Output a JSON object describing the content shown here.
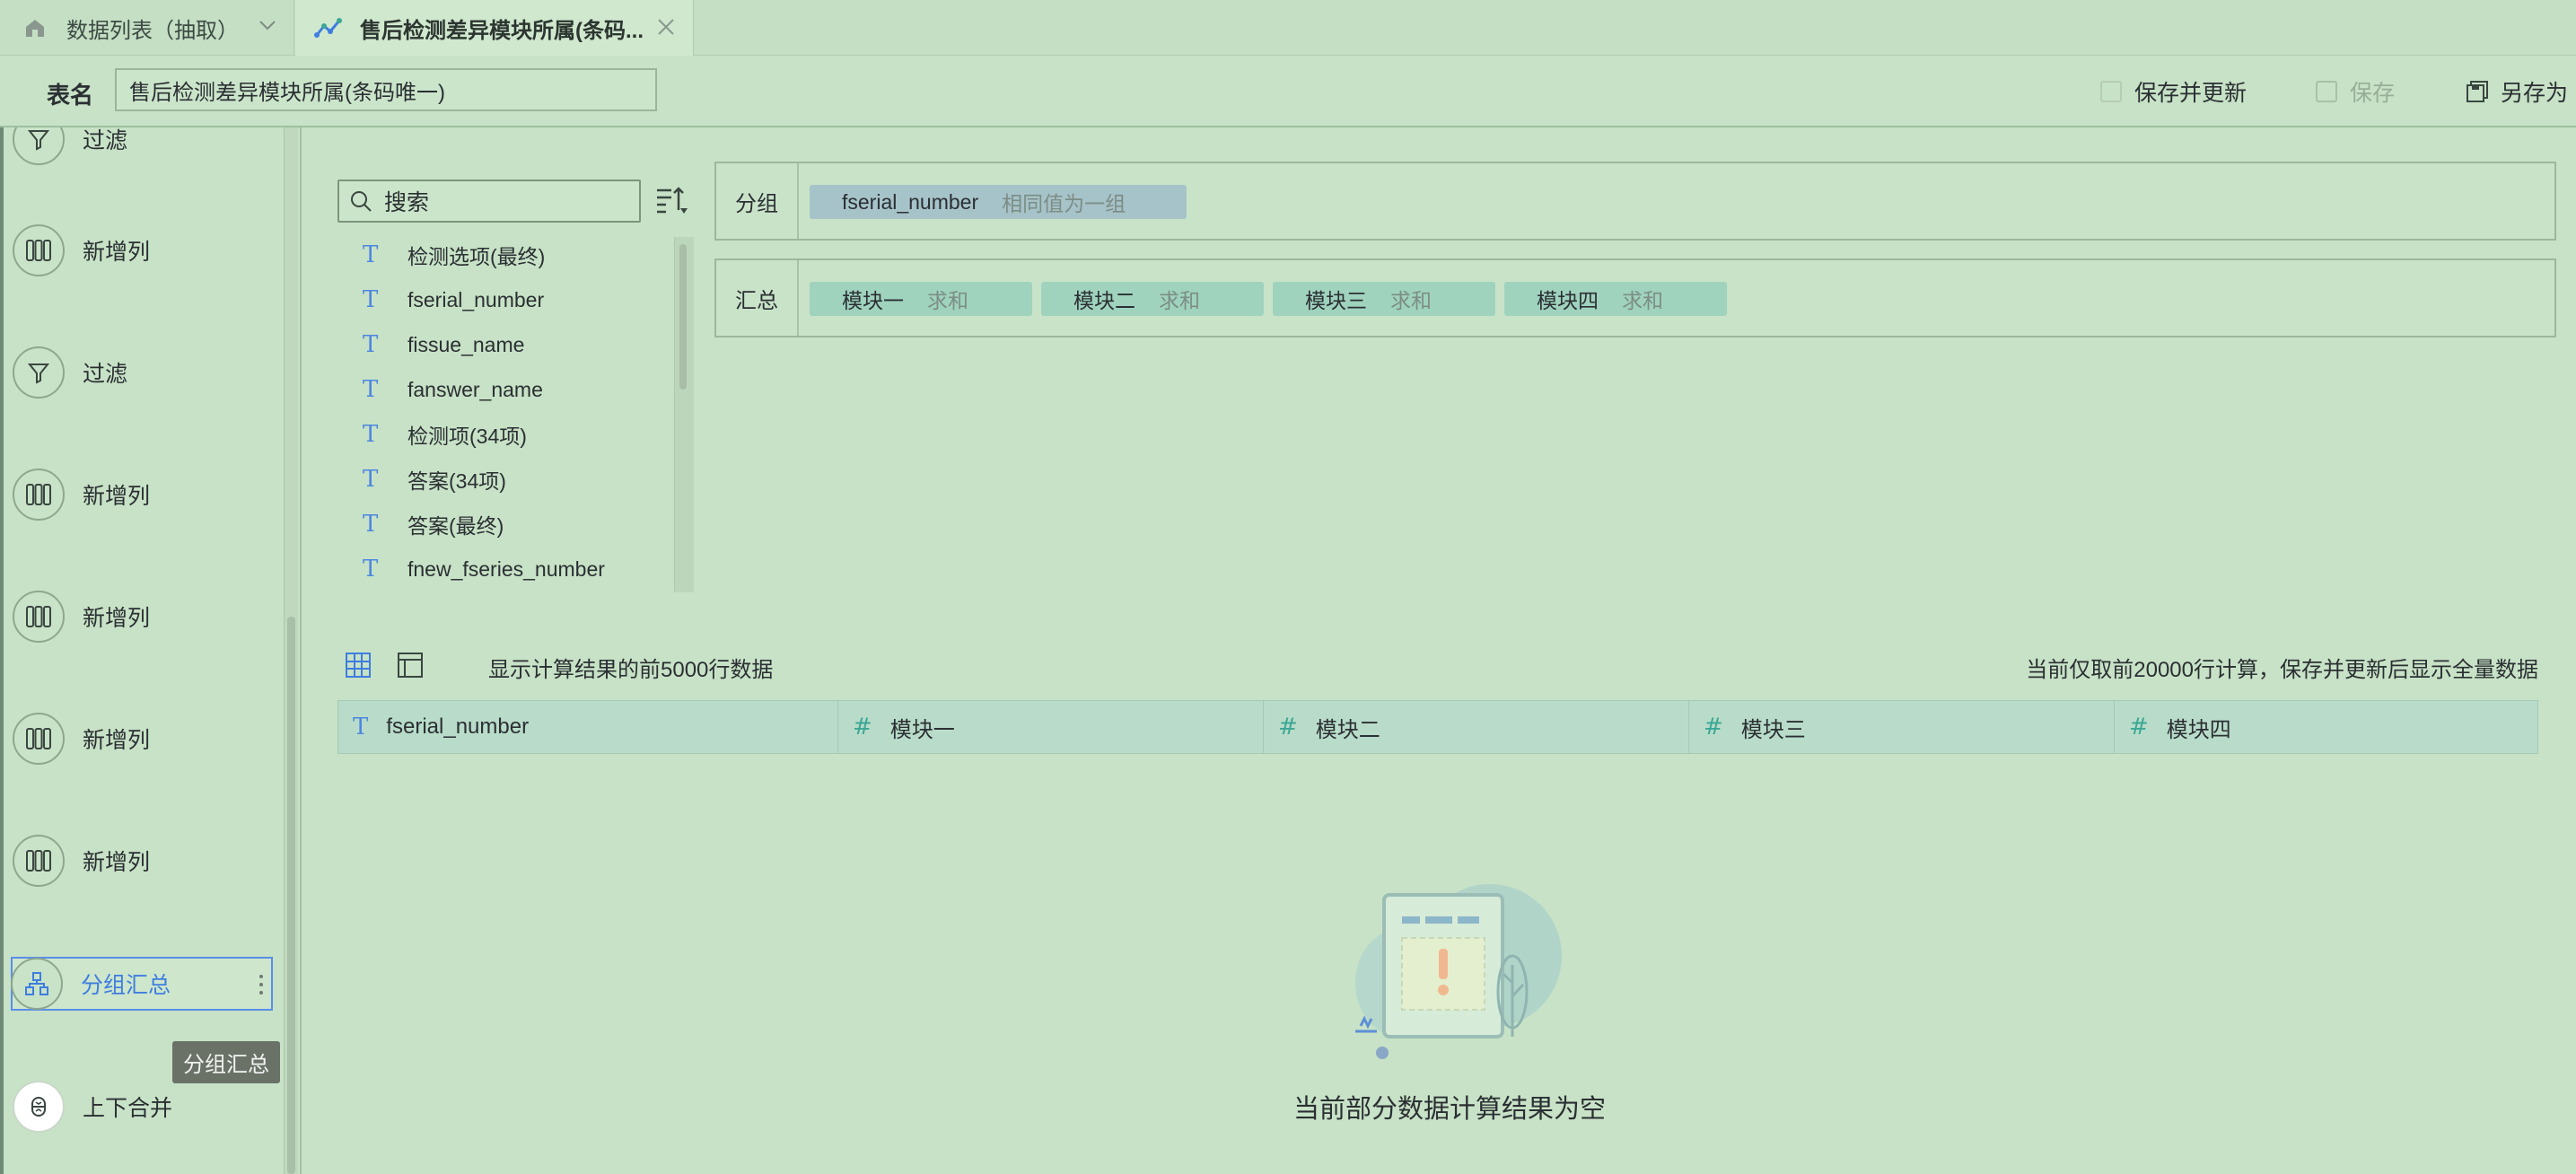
{
  "tabs": [
    {
      "label": "数据列表（抽取）"
    },
    {
      "label": "售后检测差异模块所属(条码..."
    }
  ],
  "header": {
    "table_name_label": "表名",
    "table_name_value": "售后检测差异模块所属(条码唯一)",
    "save_update_label": "保存并更新",
    "save_label": "保存",
    "save_as_label": "另存为"
  },
  "sidebar": {
    "steps": [
      {
        "label": "过滤",
        "icon": "filter-icon"
      },
      {
        "label": "新增列",
        "icon": "add-column-icon"
      },
      {
        "label": "过滤",
        "icon": "filter-icon"
      },
      {
        "label": "新增列",
        "icon": "add-column-icon"
      },
      {
        "label": "新增列",
        "icon": "add-column-icon"
      },
      {
        "label": "新增列",
        "icon": "add-column-icon"
      },
      {
        "label": "新增列",
        "icon": "add-column-icon"
      },
      {
        "label": "分组汇总",
        "icon": "group-summary-icon",
        "active": true
      },
      {
        "label": "上下合并",
        "icon": "merge-icon"
      }
    ],
    "tooltip": "分组汇总"
  },
  "fields": {
    "search_placeholder": "搜索",
    "items": [
      {
        "type": "T",
        "name": "检测选项(最终)"
      },
      {
        "type": "T",
        "name": "fserial_number"
      },
      {
        "type": "T",
        "name": "fissue_name"
      },
      {
        "type": "T",
        "name": "fanswer_name"
      },
      {
        "type": "T",
        "name": "检测项(34项)"
      },
      {
        "type": "T",
        "name": "答案(34项)"
      },
      {
        "type": "T",
        "name": "答案(最终)"
      },
      {
        "type": "T",
        "name": "fnew_fseries_number"
      }
    ]
  },
  "config": {
    "group_label": "分组",
    "group_chip": {
      "field": "fserial_number",
      "mode": "相同值为一组"
    },
    "summary_label": "汇总",
    "summary_chips": [
      {
        "field": "模块一",
        "agg": "求和"
      },
      {
        "field": "模块二",
        "agg": "求和"
      },
      {
        "field": "模块三",
        "agg": "求和"
      },
      {
        "field": "模块四",
        "agg": "求和"
      }
    ]
  },
  "preview": {
    "message": "显示计算结果的前5000行数据",
    "note": "当前仅取前20000行计算，保存并更新后显示全量数据",
    "columns": [
      {
        "type": "T",
        "name": "fserial_number"
      },
      {
        "type": "#",
        "name": "模块一"
      },
      {
        "type": "#",
        "name": "模块二"
      },
      {
        "type": "#",
        "name": "模块三"
      },
      {
        "type": "#",
        "name": "模块四"
      }
    ],
    "empty_text": "当前部分数据计算结果为空"
  },
  "colors": {
    "background": "#c7e2c6",
    "accent": "#3f7de0",
    "group_chip": "#a6c3c9",
    "sum_chip": "#9fd3be"
  }
}
